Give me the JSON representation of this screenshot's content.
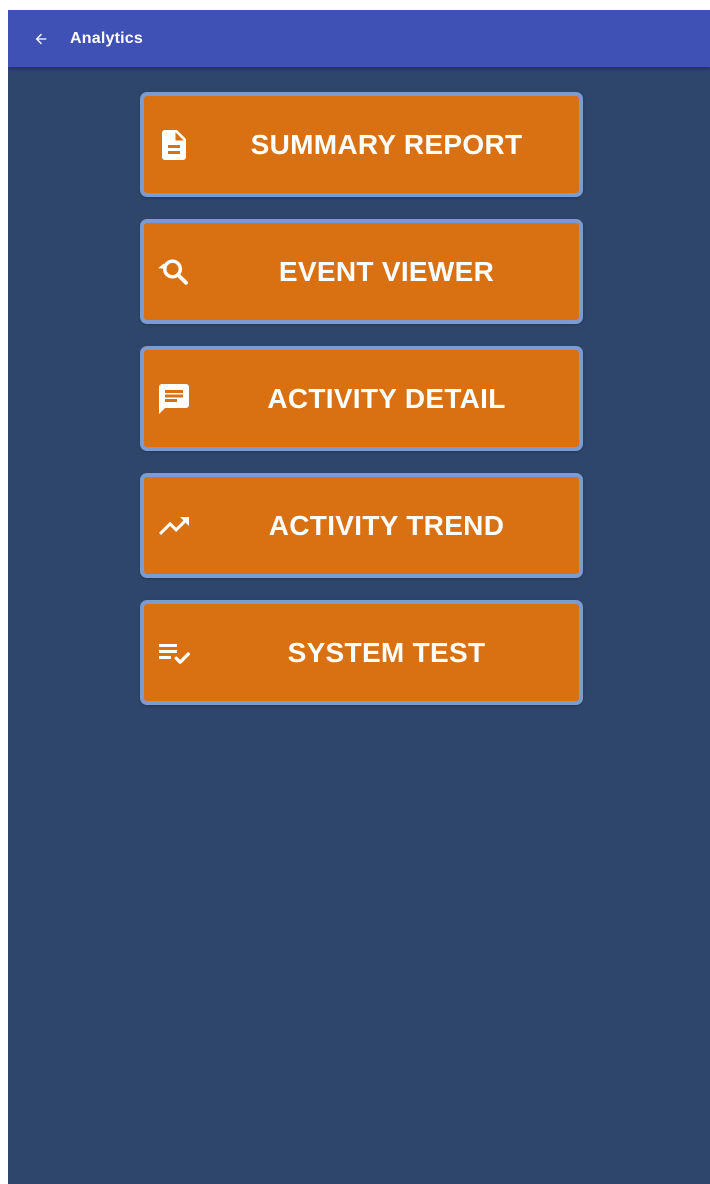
{
  "app_bar": {
    "title": "Analytics",
    "back_icon": "arrow-left-icon",
    "color": "#3f51b5"
  },
  "theme": {
    "background": "#2e4669",
    "button_fill": "#d97011",
    "button_border": "#7b9bd1",
    "text": "#ffffff"
  },
  "menu": {
    "items": [
      {
        "label": "SUMMARY REPORT",
        "icon": "document-icon"
      },
      {
        "label": "EVENT VIEWER",
        "icon": "search-history-icon"
      },
      {
        "label": "ACTIVITY DETAIL",
        "icon": "message-icon"
      },
      {
        "label": "ACTIVITY TREND",
        "icon": "trending-up-icon"
      },
      {
        "label": "SYSTEM TEST",
        "icon": "checklist-icon"
      }
    ]
  }
}
